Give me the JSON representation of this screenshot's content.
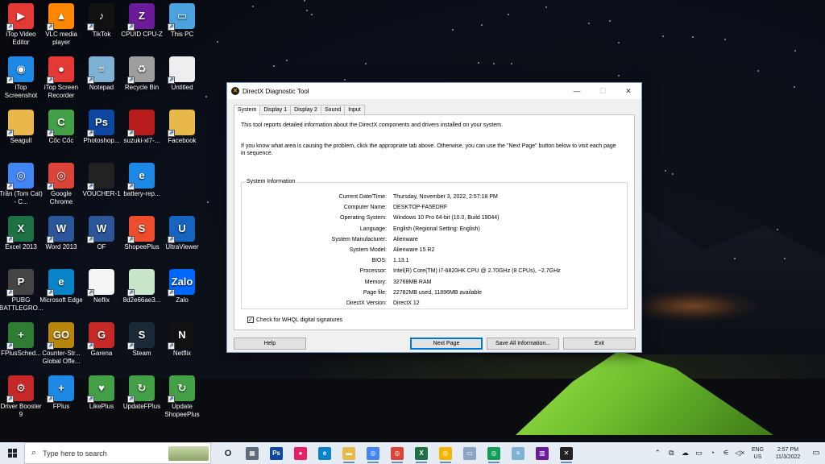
{
  "desktop_icons": [
    {
      "label": "iTop Video Editor",
      "icon": "itop-video-editor-icon",
      "color": "#e53935",
      "sym": "▶"
    },
    {
      "label": "VLC media player",
      "icon": "vlc-icon",
      "color": "#ff8800",
      "sym": "▲"
    },
    {
      "label": "TikTok",
      "icon": "tiktok-icon",
      "color": "#111111",
      "sym": "♪"
    },
    {
      "label": "CPUID CPU-Z",
      "icon": "cpuz-icon",
      "color": "#6a1b9a",
      "sym": "Z"
    },
    {
      "label": "This PC",
      "icon": "this-pc-icon",
      "color": "#4aa3df",
      "sym": "▭"
    },
    {
      "label": "iTop Screenshot",
      "icon": "itop-screenshot-icon",
      "color": "#1e88e5",
      "sym": "◉"
    },
    {
      "label": "iTop Screen Recorder",
      "icon": "itop-screen-recorder-icon",
      "color": "#e53935",
      "sym": "●"
    },
    {
      "label": "Notepad",
      "icon": "notepad-icon",
      "color": "#7fb3d5",
      "sym": "≡"
    },
    {
      "label": "Recycle Bin",
      "icon": "recycle-bin-icon",
      "color": "#9e9e9e",
      "sym": "♻"
    },
    {
      "label": "Untitled",
      "icon": "untitled-file-icon",
      "color": "#eeeeee",
      "sym": ""
    },
    {
      "label": "Seagull",
      "icon": "folder-icon",
      "color": "#e8b84a",
      "sym": ""
    },
    {
      "label": "Cốc Cốc",
      "icon": "coccoc-icon",
      "color": "#43a047",
      "sym": "C"
    },
    {
      "label": "Photoshop...",
      "icon": "photoshop-icon",
      "color": "#0d47a1",
      "sym": "Ps"
    },
    {
      "label": "suzuki-xl7-...",
      "icon": "image-file-icon",
      "color": "#b71c1c",
      "sym": ""
    },
    {
      "label": "Facebook",
      "icon": "folder-icon",
      "color": "#e8b84a",
      "sym": ""
    },
    {
      "label": "Trần (Tom Cat) - C...",
      "icon": "chrome-icon",
      "color": "#4285f4",
      "sym": "◎"
    },
    {
      "label": "Google Chrome",
      "icon": "chrome-icon",
      "color": "#db4437",
      "sym": "◎"
    },
    {
      "label": "VOUCHER-1",
      "icon": "image-file-icon",
      "color": "#222222",
      "sym": ""
    },
    {
      "label": "battery-rep...",
      "icon": "edge-legacy-icon",
      "color": "#1e88e5",
      "sym": "e"
    },
    {
      "label": "",
      "icon": "",
      "color": "",
      "sym": ""
    },
    {
      "label": "Excel 2013",
      "icon": "excel-icon",
      "color": "#1e7145",
      "sym": "X"
    },
    {
      "label": "Word 2013",
      "icon": "word-icon",
      "color": "#2b579a",
      "sym": "W"
    },
    {
      "label": "OF",
      "icon": "word-doc-icon",
      "color": "#2b579a",
      "sym": "W"
    },
    {
      "label": "ShopeePlus",
      "icon": "shopee-icon",
      "color": "#ee4d2d",
      "sym": "S"
    },
    {
      "label": "UltraViewer",
      "icon": "ultraviewer-icon",
      "color": "#1565c0",
      "sym": "U"
    },
    {
      "label": "PUBG BATTLEGRO...",
      "icon": "pubg-icon",
      "color": "#444444",
      "sym": "P"
    },
    {
      "label": "Microsoft Edge",
      "icon": "edge-icon",
      "color": "#0a84c8",
      "sym": "e"
    },
    {
      "label": "Neflix",
      "icon": "blank-file-icon",
      "color": "#f5f5f5",
      "sym": ""
    },
    {
      "label": "8d2e66ae3...",
      "icon": "image-file-icon",
      "color": "#c8e6c9",
      "sym": ""
    },
    {
      "label": "Zalo",
      "icon": "zalo-icon",
      "color": "#0068ff",
      "sym": "Zalo"
    },
    {
      "label": "FPlusSched...",
      "icon": "fplus-scheduler-icon",
      "color": "#2e7d32",
      "sym": "+"
    },
    {
      "label": "Counter-Str... Global Offe...",
      "icon": "csgo-icon",
      "color": "#b8860b",
      "sym": "GO"
    },
    {
      "label": "Garena",
      "icon": "garena-icon",
      "color": "#c62828",
      "sym": "G"
    },
    {
      "label": "Steam",
      "icon": "steam-icon",
      "color": "#1b2838",
      "sym": "S"
    },
    {
      "label": "Netflix",
      "icon": "netflix-icon",
      "color": "#111111",
      "sym": "N"
    },
    {
      "label": "Driver Booster 9",
      "icon": "driver-booster-icon",
      "color": "#c62828",
      "sym": "⚙"
    },
    {
      "label": "FPlus",
      "icon": "fplus-icon",
      "color": "#1e88e5",
      "sym": "+"
    },
    {
      "label": "LikePlus",
      "icon": "likeplus-icon",
      "color": "#43a047",
      "sym": "♥"
    },
    {
      "label": "UpdateFPlus",
      "icon": "update-fplus-icon",
      "color": "#43a047",
      "sym": "↻"
    },
    {
      "label": "Update ShopeePlus",
      "icon": "update-shopeeplus-icon",
      "color": "#43a047",
      "sym": "↻"
    }
  ],
  "window": {
    "title": "DirectX Diagnostic Tool",
    "minimize_glyph": "—",
    "maximize_glyph": "☐",
    "close_glyph": "✕",
    "tabs": [
      "System",
      "Display 1",
      "Display 2",
      "Sound",
      "Input"
    ],
    "active_tab": "System",
    "intro1": "This tool reports detailed information about the DirectX components and drivers installed on your system.",
    "intro2": "If you know what area is causing the problem, click the appropriate tab above.  Otherwise, you can use the \"Next Page\" button below to visit each page in sequence.",
    "group_title": "System Information",
    "info": [
      {
        "label": "Current Date/Time:",
        "value": "Thursday, November 3, 2022, 2:57:18 PM"
      },
      {
        "label": "Computer Name:",
        "value": "DESKTOP-FA5EDRF"
      },
      {
        "label": "Operating System:",
        "value": "Windows 10 Pro 64-bit (10.0, Build 19044)"
      },
      {
        "label": "Language:",
        "value": "English (Regional Setting: English)"
      },
      {
        "label": "System Manufacturer:",
        "value": "Alienware"
      },
      {
        "label": "System Model:",
        "value": "Alienware 15 R2"
      },
      {
        "label": "BIOS:",
        "value": "1.13.1"
      },
      {
        "label": "Processor:",
        "value": "Intel(R) Core(TM) i7-6820HK CPU @ 2.70GHz (8 CPUs), ~2.7GHz"
      },
      {
        "label": "Memory:",
        "value": "32768MB RAM"
      },
      {
        "label": "Page file:",
        "value": "22782MB used, 11896MB available"
      },
      {
        "label": "DirectX Version:",
        "value": "DirectX 12"
      }
    ],
    "whql_label": "Check for WHQL digital signatures",
    "whql_checked": true,
    "buttons": {
      "help": "Help",
      "next": "Next Page",
      "save": "Save All Information...",
      "exit": "Exit"
    }
  },
  "taskbar": {
    "search_placeholder": "Type here to search",
    "apps": [
      {
        "name": "task-view-icon",
        "color": "#333333",
        "sym": "O",
        "running": false
      },
      {
        "name": "calculator-icon",
        "color": "#5f6b7a",
        "sym": "▦",
        "running": false
      },
      {
        "name": "photoshop-taskbar-icon",
        "color": "#0d47a1",
        "sym": "Ps",
        "running": false
      },
      {
        "name": "paint3d-icon",
        "color": "#e91e63",
        "sym": "●",
        "running": false
      },
      {
        "name": "edge-taskbar-icon",
        "color": "#0a84c8",
        "sym": "e",
        "running": false
      },
      {
        "name": "file-explorer-icon",
        "color": "#e8b84a",
        "sym": "▬",
        "running": true
      },
      {
        "name": "chrome-taskbar-icon-1",
        "color": "#4285f4",
        "sym": "◎",
        "running": true
      },
      {
        "name": "chrome-taskbar-icon-2",
        "color": "#db4437",
        "sym": "◎",
        "running": true
      },
      {
        "name": "excel-taskbar-icon",
        "color": "#1e7145",
        "sym": "X",
        "running": true
      },
      {
        "name": "chrome-taskbar-icon-3",
        "color": "#f4b400",
        "sym": "◎",
        "running": true
      },
      {
        "name": "image-viewer-icon",
        "color": "#8aa4c4",
        "sym": "▭",
        "running": false
      },
      {
        "name": "chrome-taskbar-icon-4",
        "color": "#0f9d58",
        "sym": "◎",
        "running": true
      },
      {
        "name": "notepad-taskbar-icon",
        "color": "#7fb3d5",
        "sym": "≡",
        "running": false
      },
      {
        "name": "media-player-icon",
        "color": "#6a1b9a",
        "sym": "▥",
        "running": false
      },
      {
        "name": "directx-taskbar-icon",
        "color": "#222222",
        "sym": "✕",
        "running": true
      }
    ],
    "tray_icons": [
      "⌃",
      "⧉",
      "☁",
      "▭",
      "◔",
      "⚟",
      "◁×"
    ],
    "language_top": "ENG",
    "language_bottom": "US",
    "time": "2:57 PM",
    "date": "11/3/2022",
    "notification_glyph": "▭"
  }
}
